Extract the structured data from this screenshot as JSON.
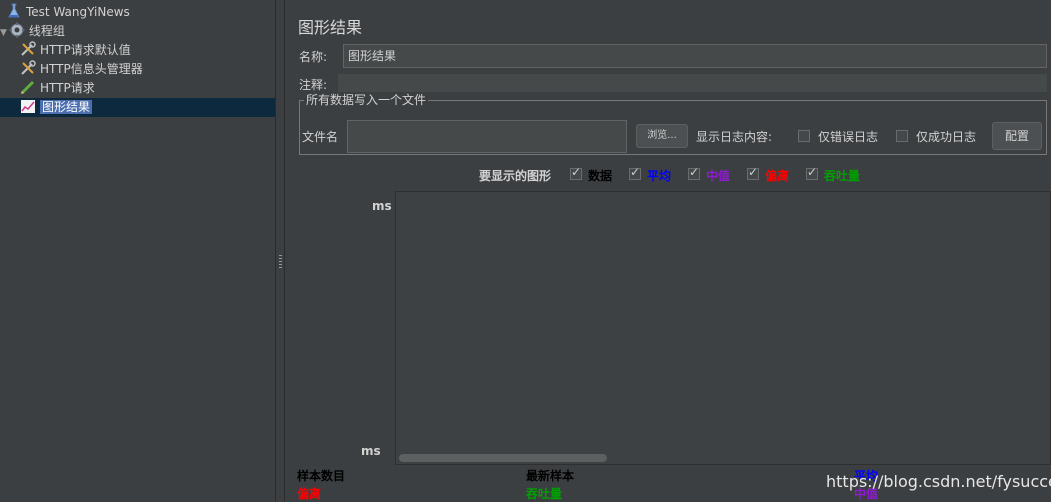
{
  "tree": {
    "items": [
      {
        "label": "Test WangYiNews",
        "icon": "flask-icon"
      },
      {
        "label": "线程组",
        "icon": "gear-icon",
        "expand": "▼"
      },
      {
        "label": "HTTP请求默认值",
        "icon": "wrench-icon"
      },
      {
        "label": "HTTP信息头管理器",
        "icon": "wrench-icon"
      },
      {
        "label": "HTTP请求",
        "icon": "pencil-icon"
      },
      {
        "label": "图形结果",
        "icon": "graph-icon",
        "selected": true
      }
    ]
  },
  "panel": {
    "title": "图形结果",
    "name_label": "名称:",
    "name_value": "图形结果",
    "comment_label": "注释:",
    "comment_value": "",
    "file_group_legend": "所有数据写入一个文件",
    "filename_label": "文件名",
    "filename_value": "",
    "browse_button": "浏览...",
    "log_content_label": "显示日志内容:",
    "errors_only_label": "仅错误日志",
    "success_only_label": "仅成功日志",
    "configure_button": "配置"
  },
  "graphs": {
    "label": "要显示的图形",
    "options": [
      {
        "label": "数据",
        "color": "#000000",
        "checked": true
      },
      {
        "label": "平均",
        "color": "#0000ff",
        "checked": true
      },
      {
        "label": "中值",
        "color": "#8e1bd0",
        "checked": true
      },
      {
        "label": "偏离",
        "color": "#ff0000",
        "checked": true
      },
      {
        "label": "吞吐量",
        "color": "#00a000",
        "checked": true
      }
    ]
  },
  "plot": {
    "y_top_label": "ms",
    "y_bottom_label": "ms"
  },
  "stats": {
    "samples_label": "样本数目",
    "latest_sample_label": "最新样本",
    "deviation_label": "偏离",
    "throughput_label": "吞吐量",
    "average_label": "平均",
    "median_label": "中值"
  },
  "watermark": "https://blog.csdn.net/fysuccess"
}
